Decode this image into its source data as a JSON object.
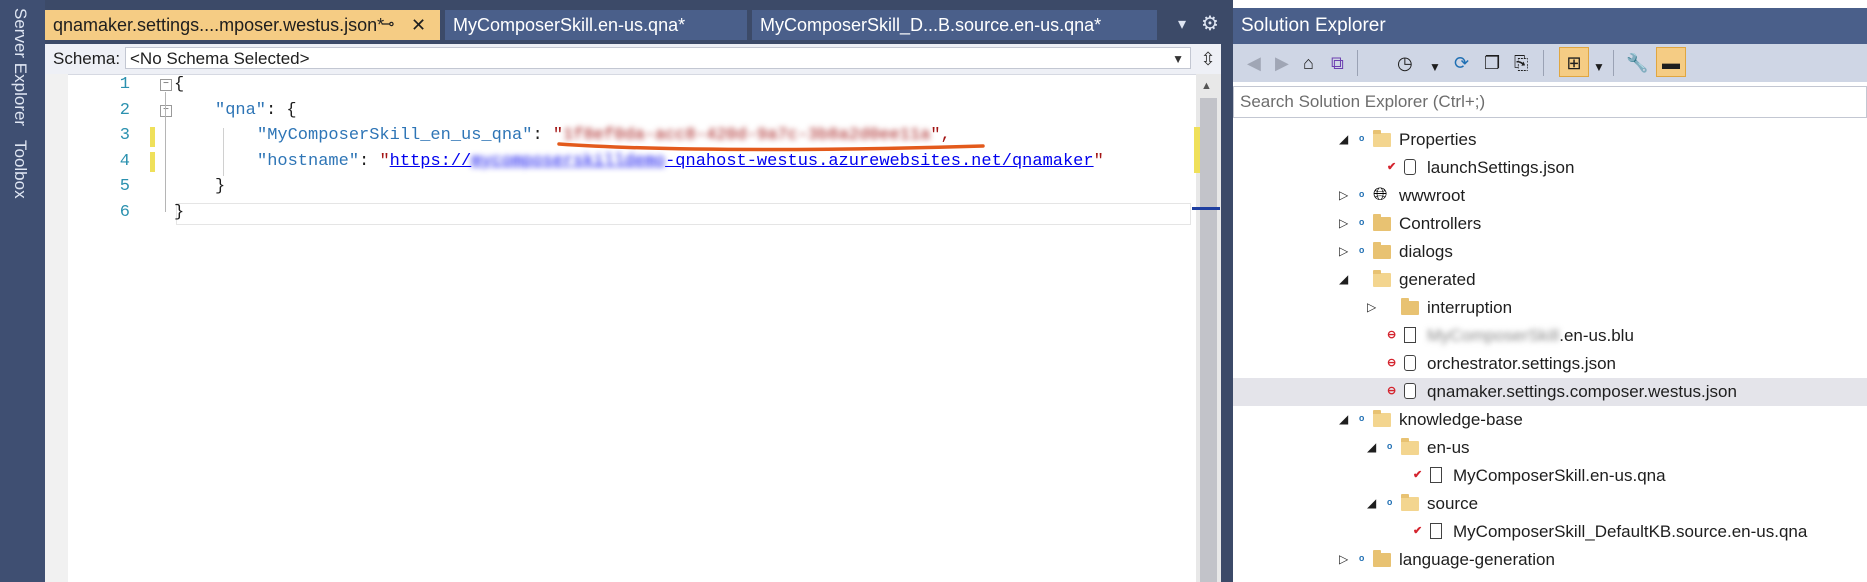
{
  "left_dock": {
    "items": [
      "Server Explorer",
      "Toolbox"
    ]
  },
  "tabs": [
    {
      "label": "qnamaker.settings....mposer.westus.json*",
      "pin": "⊸",
      "close": "✕"
    },
    {
      "label": "MyComposerSkill.en-us.qna*"
    },
    {
      "label": "MyComposerSkill_D...B.source.en-us.qna*"
    }
  ],
  "tabstrip_icons": {
    "overflow": "▾",
    "settings": "⚙"
  },
  "schema": {
    "label": "Schema:",
    "value": "<No Schema Selected>"
  },
  "code": {
    "line_numbers": [
      "1",
      "2",
      "3",
      "4",
      "5",
      "6"
    ],
    "l1": "{",
    "l2_key": "\"qna\"",
    "l2_rest": ": {",
    "l3_key": "\"MyComposerSkill_en_us_qna\"",
    "l3_sep": ": ",
    "l3_val_open": "\"",
    "l3_val_blurred": "1f8ef0da-acc8-420d-9a7c-3b8a2d0ee11a",
    "l3_val_close": "\",",
    "l4_key": "\"hostname\"",
    "l4_sep": ": ",
    "l4_q": "\"",
    "l4_url_start": "https://",
    "l4_url_blurred": "mycomposerskilldemo",
    "l4_url_end": "-qnahost-westus.azurewebsites.net/qnamaker",
    "l4_q2": "\"",
    "l5": "}",
    "l6": "}"
  },
  "solution_explorer": {
    "title": "Solution Explorer",
    "search_placeholder": "Search Solution Explorer (Ctrl+;)",
    "items": [
      {
        "label": "Properties",
        "indent": 1,
        "expander": "◢",
        "badge": "lock",
        "icon": "folder-open-icon"
      },
      {
        "label": "launchSettings.json",
        "indent": 2,
        "expander": "",
        "badge": "check",
        "icon": "json-file-icon"
      },
      {
        "label": "wwwroot",
        "indent": 1,
        "expander": "▷",
        "badge": "lock",
        "icon": "globe-icon"
      },
      {
        "label": "Controllers",
        "indent": 1,
        "expander": "▷",
        "badge": "lock",
        "icon": "folder-icon"
      },
      {
        "label": "dialogs",
        "indent": 1,
        "expander": "▷",
        "badge": "lock",
        "icon": "folder-icon"
      },
      {
        "label": "generated",
        "indent": 1,
        "expander": "◢",
        "badge": "",
        "icon": "folder-open-icon"
      },
      {
        "label": "interruption",
        "indent": 2,
        "expander": "▷",
        "badge": "",
        "icon": "folder-icon"
      },
      {
        "label": ".en-us.blu",
        "blurred_prefix": "MyComposerSkill",
        "indent": 2,
        "expander": "",
        "badge": "minus",
        "icon": "file-icon"
      },
      {
        "label": "orchestrator.settings.json",
        "indent": 2,
        "expander": "",
        "badge": "minus",
        "icon": "json-file-icon"
      },
      {
        "label": "qnamaker.settings.composer.westus.json",
        "indent": 2,
        "expander": "",
        "badge": "minus",
        "icon": "json-file-icon",
        "selected": true
      },
      {
        "label": "knowledge-base",
        "indent": 1,
        "expander": "◢",
        "badge": "lock",
        "icon": "folder-open-icon"
      },
      {
        "label": "en-us",
        "indent": 2,
        "expander": "◢",
        "badge": "lock",
        "icon": "folder-open-icon"
      },
      {
        "label": "MyComposerSkill.en-us.qna",
        "indent": 3,
        "expander": "",
        "badge": "check",
        "icon": "file-icon"
      },
      {
        "label": "source",
        "indent": 2,
        "expander": "◢",
        "badge": "lock",
        "icon": "folder-open-icon"
      },
      {
        "label": "MyComposerSkill_DefaultKB.source.en-us.qna",
        "indent": 3,
        "expander": "",
        "badge": "check",
        "icon": "file-icon"
      },
      {
        "label": "language-generation",
        "indent": 1,
        "expander": "▷",
        "badge": "lock",
        "icon": "folder-icon"
      }
    ]
  }
}
